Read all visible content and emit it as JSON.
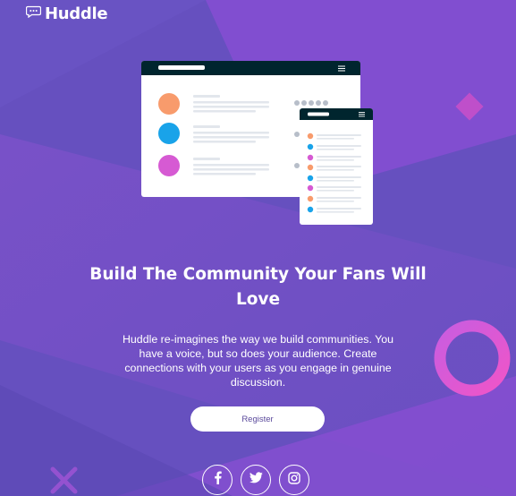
{
  "brand": {
    "name": "Huddle",
    "logo_icon": "chat-bubble-icon"
  },
  "hero": {
    "headline": "Build The Community Your Fans Will Love",
    "description": "Huddle re-imagines the way we build communities. You have a voice, but so does your audience. Create connections with your users as you engage in genuine discussion.",
    "register_label": "Register"
  },
  "social": [
    {
      "name": "facebook",
      "icon": "facebook-icon"
    },
    {
      "name": "twitter",
      "icon": "twitter-icon"
    },
    {
      "name": "instagram",
      "icon": "instagram-icon"
    }
  ],
  "colors": {
    "background": "#6b4fc0",
    "accent_pink": "#e95cd2",
    "button_text": "#5b4a9c",
    "mockup_header": "#00252e"
  }
}
